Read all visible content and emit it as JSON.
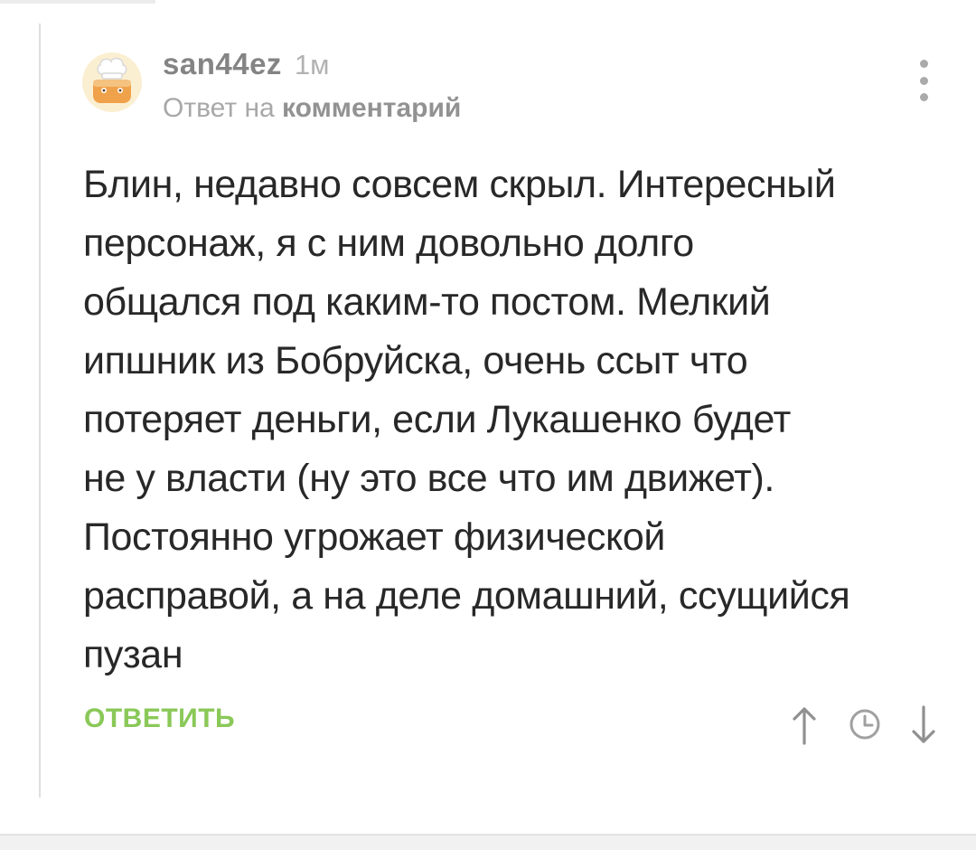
{
  "comment": {
    "author": "san44ez",
    "time": "1м",
    "reply_prefix": "Ответ на",
    "reply_link": "комментарий",
    "body_lines": [
      "Блин, недавно совсем скрыл. Интересный",
      "персонаж, я с ним довольно долго",
      "общался под каким-то постом. Мелкий",
      "ипшник из Бобруйска, очень ссыт что",
      "потеряет деньги, если Лукашенко будет",
      "не у власти (ну это все что им движет).",
      "Постоянно угрожает физической",
      "расправой, а на деле домашний, ссущийся",
      "пузан"
    ],
    "reply_button": "ОТВЕТИТЬ",
    "avatar_icon": "chef-hat-avatar-icon",
    "menu_icon": "more-vertical-icon",
    "action_icons": [
      "arrow-up-icon",
      "clock-icon",
      "arrow-down-icon"
    ]
  },
  "colors": {
    "accent_green": "#8ac858",
    "text": "#282828",
    "muted": "#a8a8a8"
  }
}
